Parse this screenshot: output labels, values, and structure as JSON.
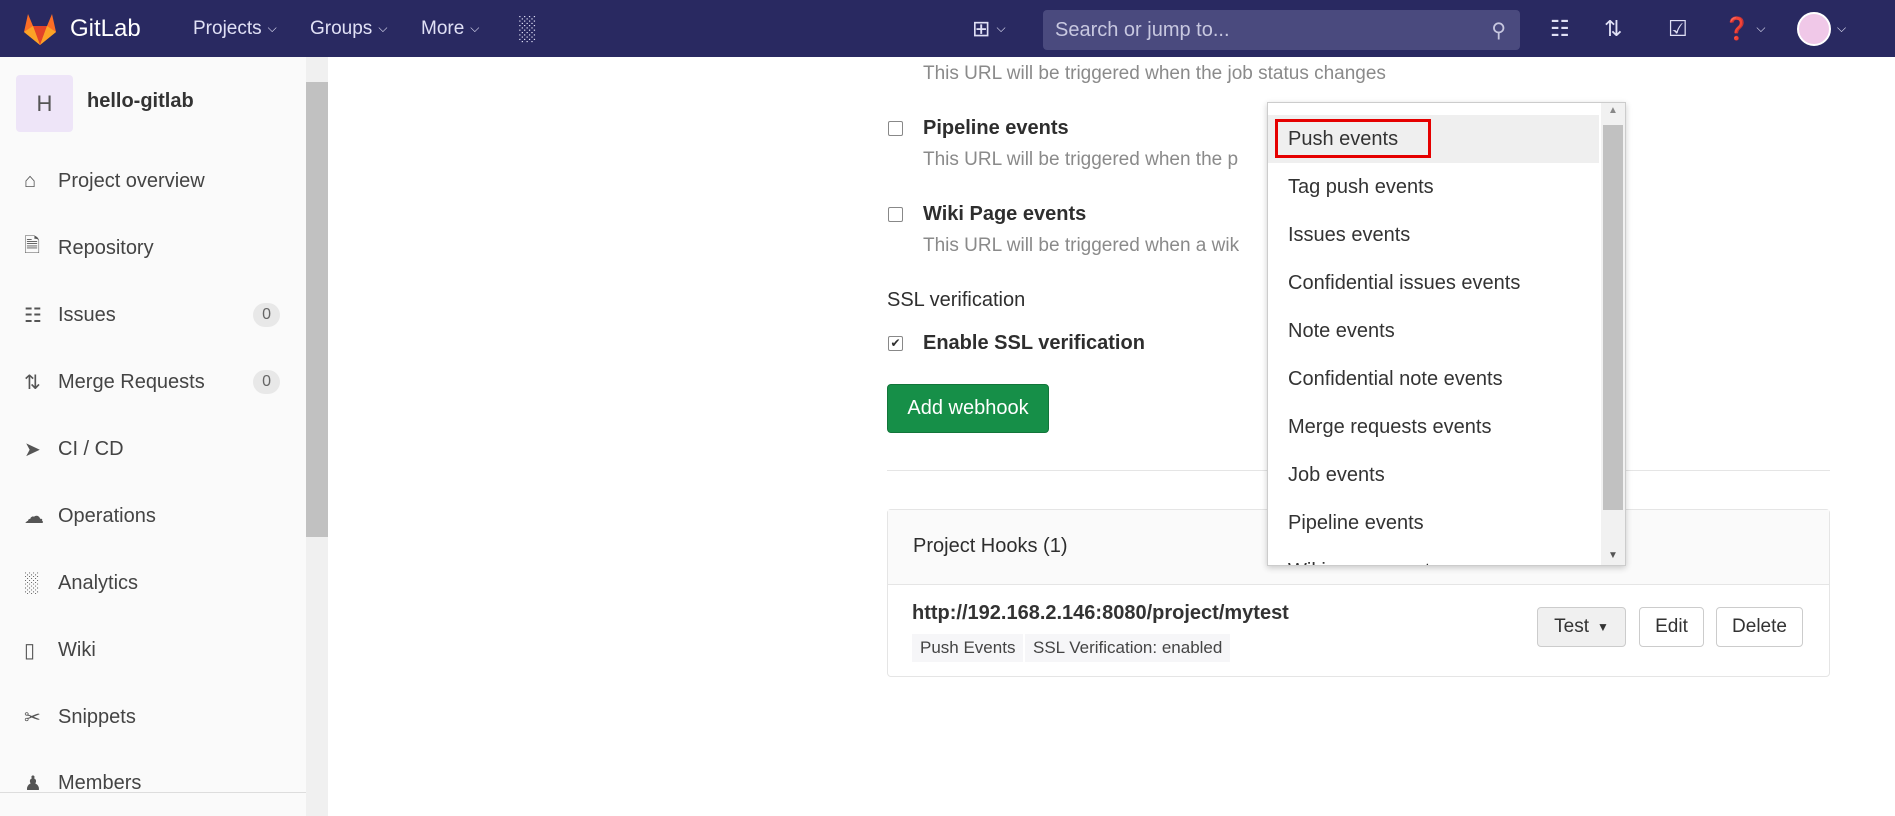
{
  "header": {
    "brand": "GitLab",
    "nav": [
      "Projects",
      "Groups",
      "More"
    ],
    "search_placeholder": "Search or jump to...",
    "colors": {
      "bg": "#292961",
      "accent": "#168f48"
    }
  },
  "sidebar": {
    "avatar_letter": "H",
    "project": "hello-gitlab",
    "items": [
      {
        "label": "Project overview",
        "icon": "home-icon"
      },
      {
        "label": "Repository",
        "icon": "doc-icon"
      },
      {
        "label": "Issues",
        "icon": "issues-icon",
        "badge": "0"
      },
      {
        "label": "Merge Requests",
        "icon": "merge-icon",
        "badge": "0"
      },
      {
        "label": "CI / CD",
        "icon": "rocket-icon"
      },
      {
        "label": "Operations",
        "icon": "cloud-icon"
      },
      {
        "label": "Analytics",
        "icon": "chart-icon"
      },
      {
        "label": "Wiki",
        "icon": "book-icon"
      },
      {
        "label": "Snippets",
        "icon": "scissors-icon"
      },
      {
        "label": "Members",
        "icon": "users-icon"
      }
    ]
  },
  "form": {
    "job_desc": "This URL will be triggered when the job status changes",
    "pipeline_label": "Pipeline events",
    "pipeline_desc": "This URL will be triggered when the p",
    "wiki_label": "Wiki Page events",
    "wiki_desc": "This URL will be triggered when a wik",
    "ssl_heading": "SSL verification",
    "ssl_label": "Enable SSL verification",
    "ssl_checked": true,
    "add_button": "Add webhook"
  },
  "hooks": {
    "title": "Project Hooks (1)",
    "url": "http://192.168.2.146:8080/project/mytest",
    "tags": [
      "Push Events",
      "SSL Verification: enabled"
    ],
    "test": "Test",
    "edit": "Edit",
    "delete": "Delete"
  },
  "dropdown": {
    "options": [
      "Push events",
      "Tag push events",
      "Issues events",
      "Confidential issues events",
      "Note events",
      "Confidential note events",
      "Merge requests events",
      "Job events",
      "Pipeline events",
      "Wiki page events"
    ],
    "selected": "Push events"
  }
}
